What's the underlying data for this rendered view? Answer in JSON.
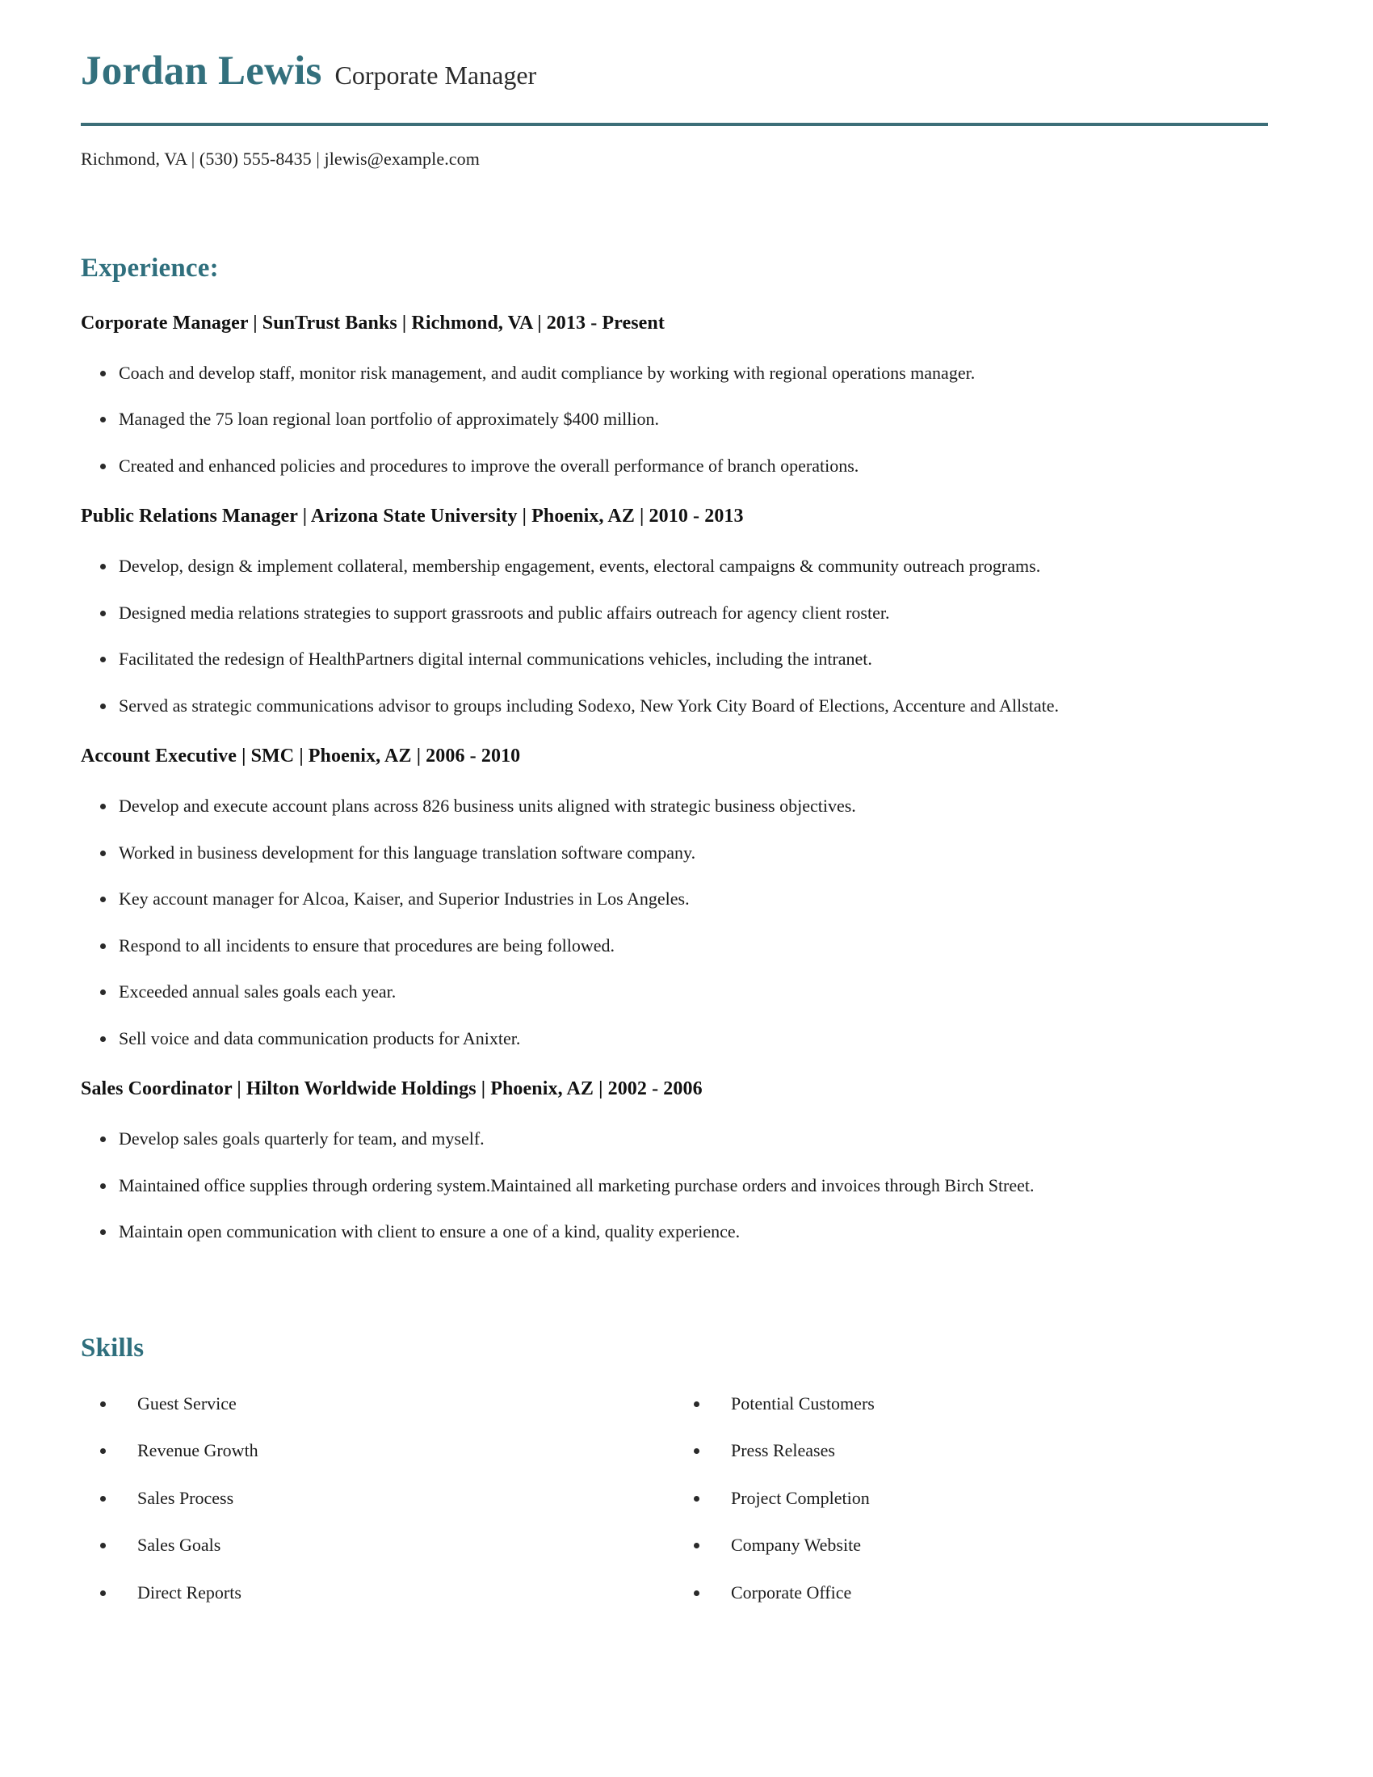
{
  "header": {
    "name": "Jordan Lewis",
    "title": "Corporate Manager",
    "contact": "Richmond, VA  |  (530) 555-8435  |  jlewis@example.com",
    "accent_color": "#33707d",
    "rule_color": "#3c6e78"
  },
  "experience": {
    "heading": "Experience:",
    "jobs": [
      {
        "heading": "Corporate Manager | SunTrust Banks | Richmond, VA | 2013 - Present",
        "bullets": [
          "Coach and develop staff, monitor risk management, and audit compliance by working with regional operations manager.",
          "Managed the 75 loan regional loan portfolio of approximately $400 million.",
          "Created and enhanced policies and procedures to improve the overall performance of branch operations."
        ]
      },
      {
        "heading": "Public Relations Manager | Arizona State University | Phoenix, AZ | 2010 - 2013",
        "bullets": [
          "Develop, design & implement collateral, membership engagement, events, electoral campaigns & community outreach programs.",
          "Designed media relations strategies to support grassroots and public affairs outreach for agency client roster.",
          "Facilitated the redesign of HealthPartners digital internal communications vehicles, including the intranet.",
          "Served as strategic communications advisor to groups including Sodexo, New York City Board of Elections, Accenture and Allstate."
        ]
      },
      {
        "heading": "Account Executive | SMC | Phoenix, AZ |  2006 - 2010",
        "bullets": [
          "Develop and execute account plans across 826 business units aligned with strategic business objectives.",
          "Worked in business development for this language translation software company.",
          "Key account manager for Alcoa, Kaiser, and Superior Industries in Los Angeles.",
          "Respond to all incidents to ensure that procedures are being followed.",
          "Exceeded annual sales goals each year.",
          "Sell voice and data communication products for Anixter."
        ]
      },
      {
        "heading": "Sales Coordinator | Hilton Worldwide Holdings | Phoenix, AZ | 2002 - 2006",
        "bullets": [
          "Develop sales goals quarterly for team, and myself.",
          "Maintained office supplies through ordering system.Maintained all marketing purchase orders and invoices through Birch Street.",
          "Maintain open communication with client to ensure a one of a kind, quality experience."
        ]
      }
    ]
  },
  "skills": {
    "heading": "Skills",
    "column_left": [
      "Guest Service",
      "Revenue Growth",
      "Sales Process",
      "Sales Goals",
      "Direct Reports"
    ],
    "column_right": [
      "Potential Customers",
      "Press Releases",
      "Project Completion",
      "Company Website",
      "Corporate Office"
    ]
  }
}
